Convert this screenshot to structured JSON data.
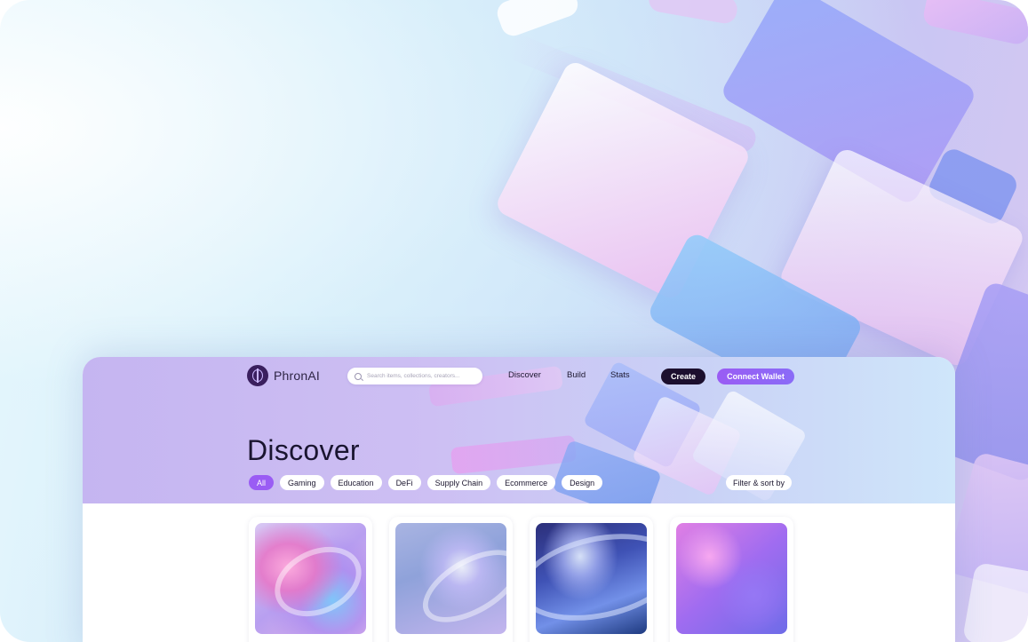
{
  "brand": {
    "name": "PhronAI",
    "icon": "phronai-logo-icon"
  },
  "search": {
    "placeholder": "Search items, collections, creators..."
  },
  "nav": {
    "discover": "Discover",
    "build": "Build",
    "stats": "Stats"
  },
  "buttons": {
    "create": "Create",
    "connect_wallet": "Connect Wallet"
  },
  "page": {
    "title": "Discover"
  },
  "categories": [
    "All",
    "Gaming",
    "Education",
    "DeFi",
    "Supply Chain",
    "Ecommerce",
    "Design"
  ],
  "active_category": "All",
  "filter": {
    "label": "Filter & sort by"
  },
  "colors": {
    "accent": "#9a5cf4",
    "dark_button": "#1c0f2e",
    "text": "#1a1530"
  }
}
